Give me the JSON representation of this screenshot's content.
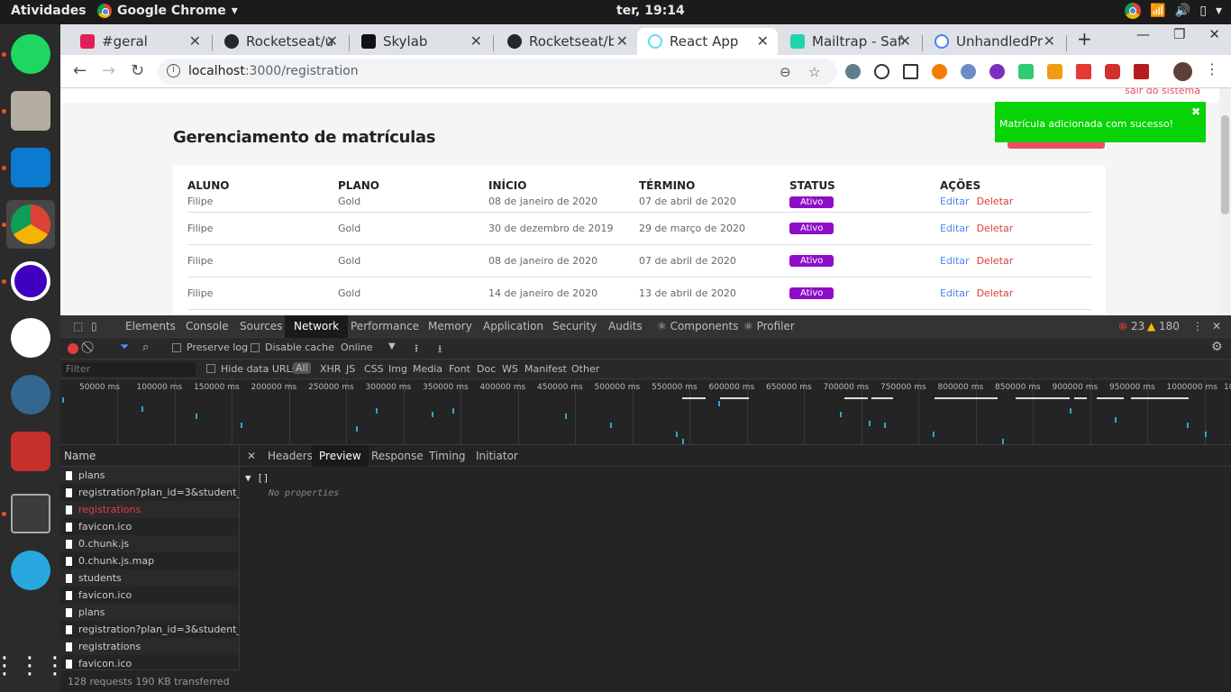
{
  "topbar": {
    "activities": "Atividades",
    "app_name": "Google Chrome",
    "clock": "ter, 19:14"
  },
  "tabs": [
    {
      "title": "#geral",
      "fav_color": "#e01e5a"
    },
    {
      "title": "Rocketseat/u",
      "fav_color": "#24292e"
    },
    {
      "title": "Skylab",
      "fav_color": "#111111"
    },
    {
      "title": "Rocketseat/b",
      "fav_color": "#24292e"
    },
    {
      "title": "React App",
      "fav_color": "#61dafb"
    },
    {
      "title": "Mailtrap - Safe",
      "fav_color": "#22d3b0"
    },
    {
      "title": "UnhandledPr",
      "fav_color": "#4285f4"
    }
  ],
  "toolbar": {
    "url_host": "localhost",
    "url_path": ":3000/registration"
  },
  "page": {
    "logout": "sair do sistema",
    "title": "Gerenciamento de matrículas",
    "columns": [
      "ALUNO",
      "PLANO",
      "INÍCIO",
      "TÉRMINO",
      "STATUS",
      "AÇÕES"
    ],
    "rows": [
      {
        "aluno": "Filipe",
        "plano": "Gold",
        "inicio": "08 de janeiro de 2020",
        "termino": "07 de abril de 2020",
        "status": "Ativo"
      },
      {
        "aluno": "Filipe",
        "plano": "Gold",
        "inicio": "30 de dezembro de 2019",
        "termino": "29 de março de 2020",
        "status": "Ativo"
      },
      {
        "aluno": "Filipe",
        "plano": "Gold",
        "inicio": "08 de janeiro de 2020",
        "termino": "07 de abril de 2020",
        "status": "Ativo"
      },
      {
        "aluno": "Filipe",
        "plano": "Gold",
        "inicio": "14 de janeiro de 2020",
        "termino": "13 de abril de 2020",
        "status": "Ativo"
      }
    ],
    "edit_label": "Editar",
    "delete_label": "Deletar",
    "toast": "Matrícula adicionada com sucesso!"
  },
  "devtools": {
    "tabs": [
      "Elements",
      "Console",
      "Sources",
      "Network",
      "Performance",
      "Memory",
      "Application",
      "Security",
      "Audits",
      "⚛ Components",
      "⚛ Profiler"
    ],
    "errors": "23",
    "warnings": "180",
    "preserve_log": "Preserve log",
    "disable_cache": "Disable cache",
    "throttle": "Online",
    "filter_placeholder": "Filter",
    "hide_data_urls": "Hide data URLs",
    "filter_types": [
      "All",
      "XHR",
      "JS",
      "CSS",
      "Img",
      "Media",
      "Font",
      "Doc",
      "WS",
      "Manifest",
      "Other"
    ],
    "ticks": [
      "50000 ms",
      "100000 ms",
      "150000 ms",
      "200000 ms",
      "250000 ms",
      "300000 ms",
      "350000 ms",
      "400000 ms",
      "450000 ms",
      "500000 ms",
      "550000 ms",
      "600000 ms",
      "650000 ms",
      "700000 ms",
      "750000 ms",
      "800000 ms",
      "850000 ms",
      "900000 ms",
      "950000 ms",
      "1000000 ms",
      "10"
    ],
    "name_header": "Name",
    "requests": [
      {
        "name": "plans",
        "error": false
      },
      {
        "name": "registration?plan_id=3&student_i...",
        "error": false
      },
      {
        "name": "registrations",
        "error": true
      },
      {
        "name": "favicon.ico",
        "error": false
      },
      {
        "name": "0.chunk.js",
        "error": false
      },
      {
        "name": "0.chunk.js.map",
        "error": false
      },
      {
        "name": "students",
        "error": false
      },
      {
        "name": "favicon.ico",
        "error": false
      },
      {
        "name": "plans",
        "error": false
      },
      {
        "name": "registration?plan_id=3&student_i...",
        "error": false
      },
      {
        "name": "registrations",
        "error": false
      },
      {
        "name": "favicon.ico",
        "error": false
      }
    ],
    "footer": "128 requests    190 KB transferred",
    "detail_tabs": [
      "Headers",
      "Preview",
      "Response",
      "Timing",
      "Initiator"
    ],
    "preview_root": "▼ []",
    "preview_empty": "No properties"
  }
}
